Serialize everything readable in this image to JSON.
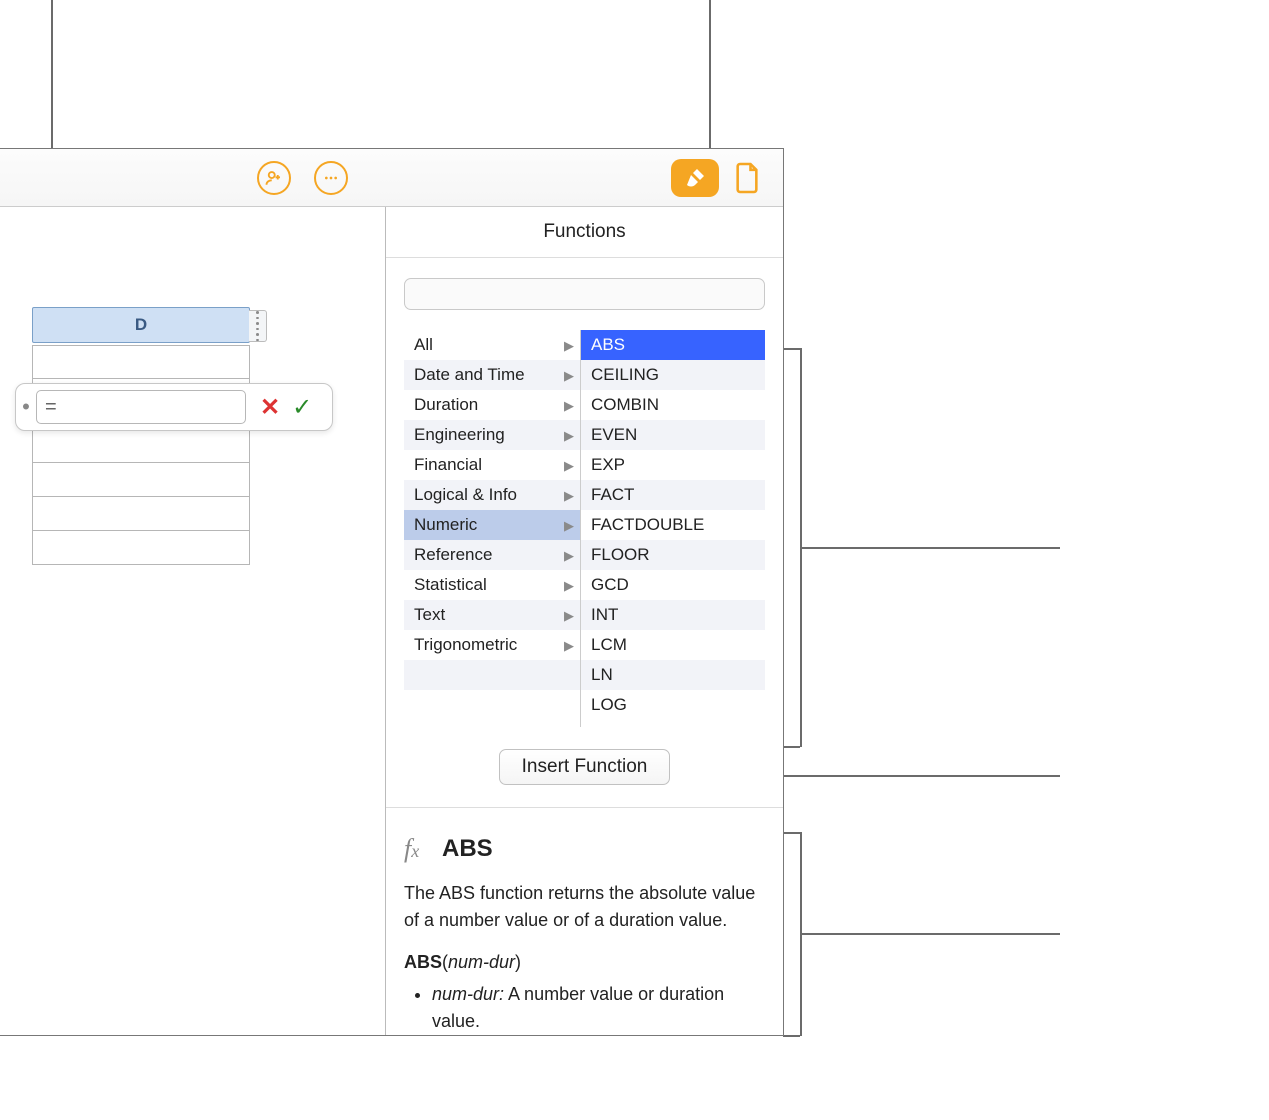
{
  "toolbar": {
    "add_user_icon": "add-user-icon",
    "more_icon": "more-icon",
    "format_icon": "format-icon",
    "document_icon": "document-icon"
  },
  "sheet": {
    "column_header": "D"
  },
  "formula_editor": {
    "value": "="
  },
  "panel": {
    "title": "Functions",
    "search_placeholder": "",
    "categories": [
      "All",
      "Date and Time",
      "Duration",
      "Engineering",
      "Financial",
      "Logical & Info",
      "Numeric",
      "Reference",
      "Statistical",
      "Text",
      "Trigonometric"
    ],
    "selected_category_index": 6,
    "functions": [
      "ABS",
      "CEILING",
      "COMBIN",
      "EVEN",
      "EXP",
      "FACT",
      "FACTDOUBLE",
      "FLOOR",
      "GCD",
      "INT",
      "LCM",
      "LN",
      "LOG"
    ],
    "selected_function_index": 0,
    "insert_button": "Insert Function",
    "detail": {
      "name": "ABS",
      "description": "The ABS function returns the absolute value of a number value or of a duration value.",
      "signature_name": "ABS",
      "signature_args": "num-dur",
      "args": [
        {
          "name": "num-dur",
          "desc": "A number value or duration value."
        }
      ]
    }
  }
}
